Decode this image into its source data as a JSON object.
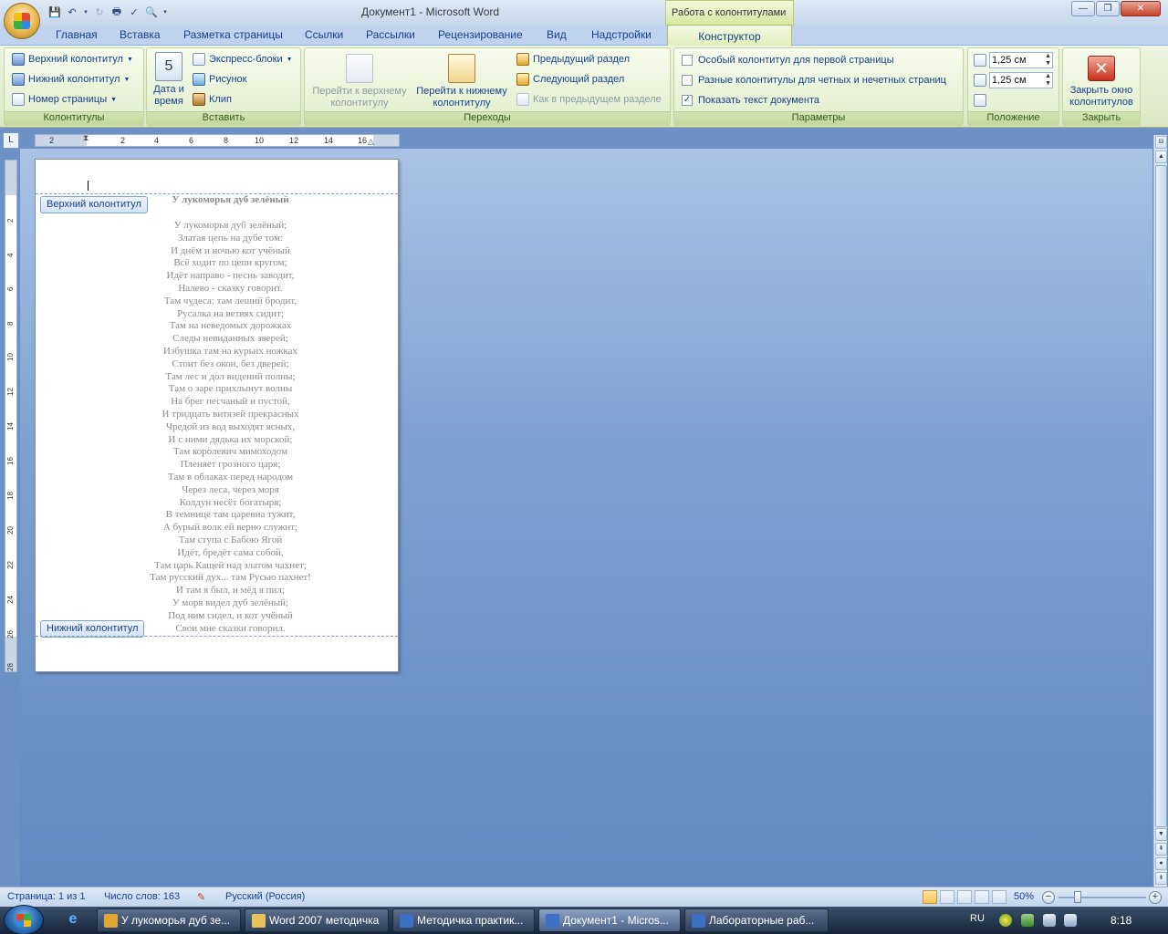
{
  "window": {
    "title": "Документ1 - Microsoft Word",
    "context_title": "Работа с колонтитулами",
    "controls": {
      "minimize": "—",
      "maximize": "❐",
      "close": "✕"
    }
  },
  "tabs": [
    "Главная",
    "Вставка",
    "Разметка страницы",
    "Ссылки",
    "Рассылки",
    "Рецензирование",
    "Вид",
    "Надстройки",
    "Конструктор"
  ],
  "ribbon": {
    "group_kolontituly": {
      "label": "Колонтитулы",
      "header_btn": "Верхний колонтитул",
      "footer_btn": "Нижний колонтитул",
      "page_number_btn": "Номер страницы"
    },
    "group_insert": {
      "label": "Вставить",
      "date_time_line1": "Дата и",
      "date_time_line2": "время",
      "express_blocks": "Экспресс-блоки",
      "picture": "Рисунок",
      "clip": "Клип"
    },
    "group_navigation": {
      "label": "Переходы",
      "goto_header_line1": "Перейти к верхнему",
      "goto_header_line2": "колонтитулу",
      "goto_footer_line1": "Перейти к нижнему",
      "goto_footer_line2": "колонтитулу",
      "prev_section": "Предыдущий раздел",
      "next_section": "Следующий раздел",
      "link_to_previous": "Как в предыдущем разделе"
    },
    "group_params": {
      "label": "Параметры",
      "first_page": {
        "label": "Особый колонтитул для первой страницы",
        "checked": false
      },
      "odd_even": {
        "label": "Разные колонтитулы для четных и нечетных страниц",
        "checked": false
      },
      "show_text": {
        "label": "Показать текст документа",
        "checked": true
      }
    },
    "group_position": {
      "label": "Положение",
      "header_distance": "1,25 см",
      "footer_distance": "1,25 см"
    },
    "group_close": {
      "label": "Закрыть",
      "close_line1": "Закрыть окно",
      "close_line2": "колонтитулов"
    }
  },
  "ruler": {
    "horizontal_ticks": [
      "2",
      "2",
      "4",
      "6",
      "8",
      "10",
      "12",
      "14",
      "16"
    ],
    "vertical_ticks": [
      "2",
      "4",
      "6",
      "8",
      "10",
      "12",
      "14",
      "16",
      "18",
      "20",
      "22",
      "24",
      "26",
      "28"
    ]
  },
  "document": {
    "header_tag": "Верхний колонтитул",
    "footer_tag": "Нижний колонтитул",
    "poem_title": "У лукоморья дуб зелёный",
    "poem_lines": [
      "У лукоморья дуб зелёный;",
      "Златая цепь на дубе том:",
      "И днём и ночью кот учёный",
      "Всё ходит по цепи кругом;",
      "Идёт направо - песнь заводит,",
      "Налево - сказку говорит.",
      "Там чудеса: там леший бродит,",
      "Русалка на ветвях сидит;",
      "Там на неведомых дорожках",
      "Следы невиданных  зверей;",
      "Избушка там на курьих ножках",
      "Стоит без окон, без дверей;",
      "Там лес и дол видений полны;",
      "Там о заре прихлынут волны",
      "На брег песчаный  и пустой,",
      "И тридцать витязей прекрасных",
      "Чредой из вод выходят ясных,",
      "И с ними дядька их морской;",
      "Там королевич мимоходом",
      "Пленяет грозного царя;",
      "Там в облаках перед народом",
      "Через леса, через моря",
      "Колдун несёт богатыря;",
      "В темнице там царевна тужит,",
      "А бурый волк ей верно служит;",
      "Там ступа с Бабою Ягой",
      "Идёт, бредёт сама собой,",
      "Там царь Кащей над златом чахнет;",
      "Там русский дух... там Русью пахнет!",
      "И там я был, и мёд я пил;",
      "У моря видел дуб зелёный;",
      "Под ним сидел, и кот учёный",
      "Свои мне сказки говорил."
    ]
  },
  "statusbar": {
    "page": "Страница: 1 из 1",
    "words": "Число слов: 163",
    "language": "Русский (Россия)",
    "zoom": "50%"
  },
  "taskbar": {
    "items": [
      {
        "label": "У лукоморья дуб зе...",
        "icon": "chrome-icon",
        "color": "#e0a630"
      },
      {
        "label": "Word 2007 методичка",
        "icon": "folder-icon",
        "color": "#e8c35a"
      },
      {
        "label": "Методичка практик...",
        "icon": "word-icon",
        "color": "#3e6fc4"
      },
      {
        "label": "Документ1 - Micros...",
        "icon": "word-icon",
        "color": "#3e6fc4"
      },
      {
        "label": "Лабораторные раб...",
        "icon": "word-icon",
        "color": "#3e6fc4"
      }
    ],
    "lang": "RU",
    "time": "8:18"
  }
}
